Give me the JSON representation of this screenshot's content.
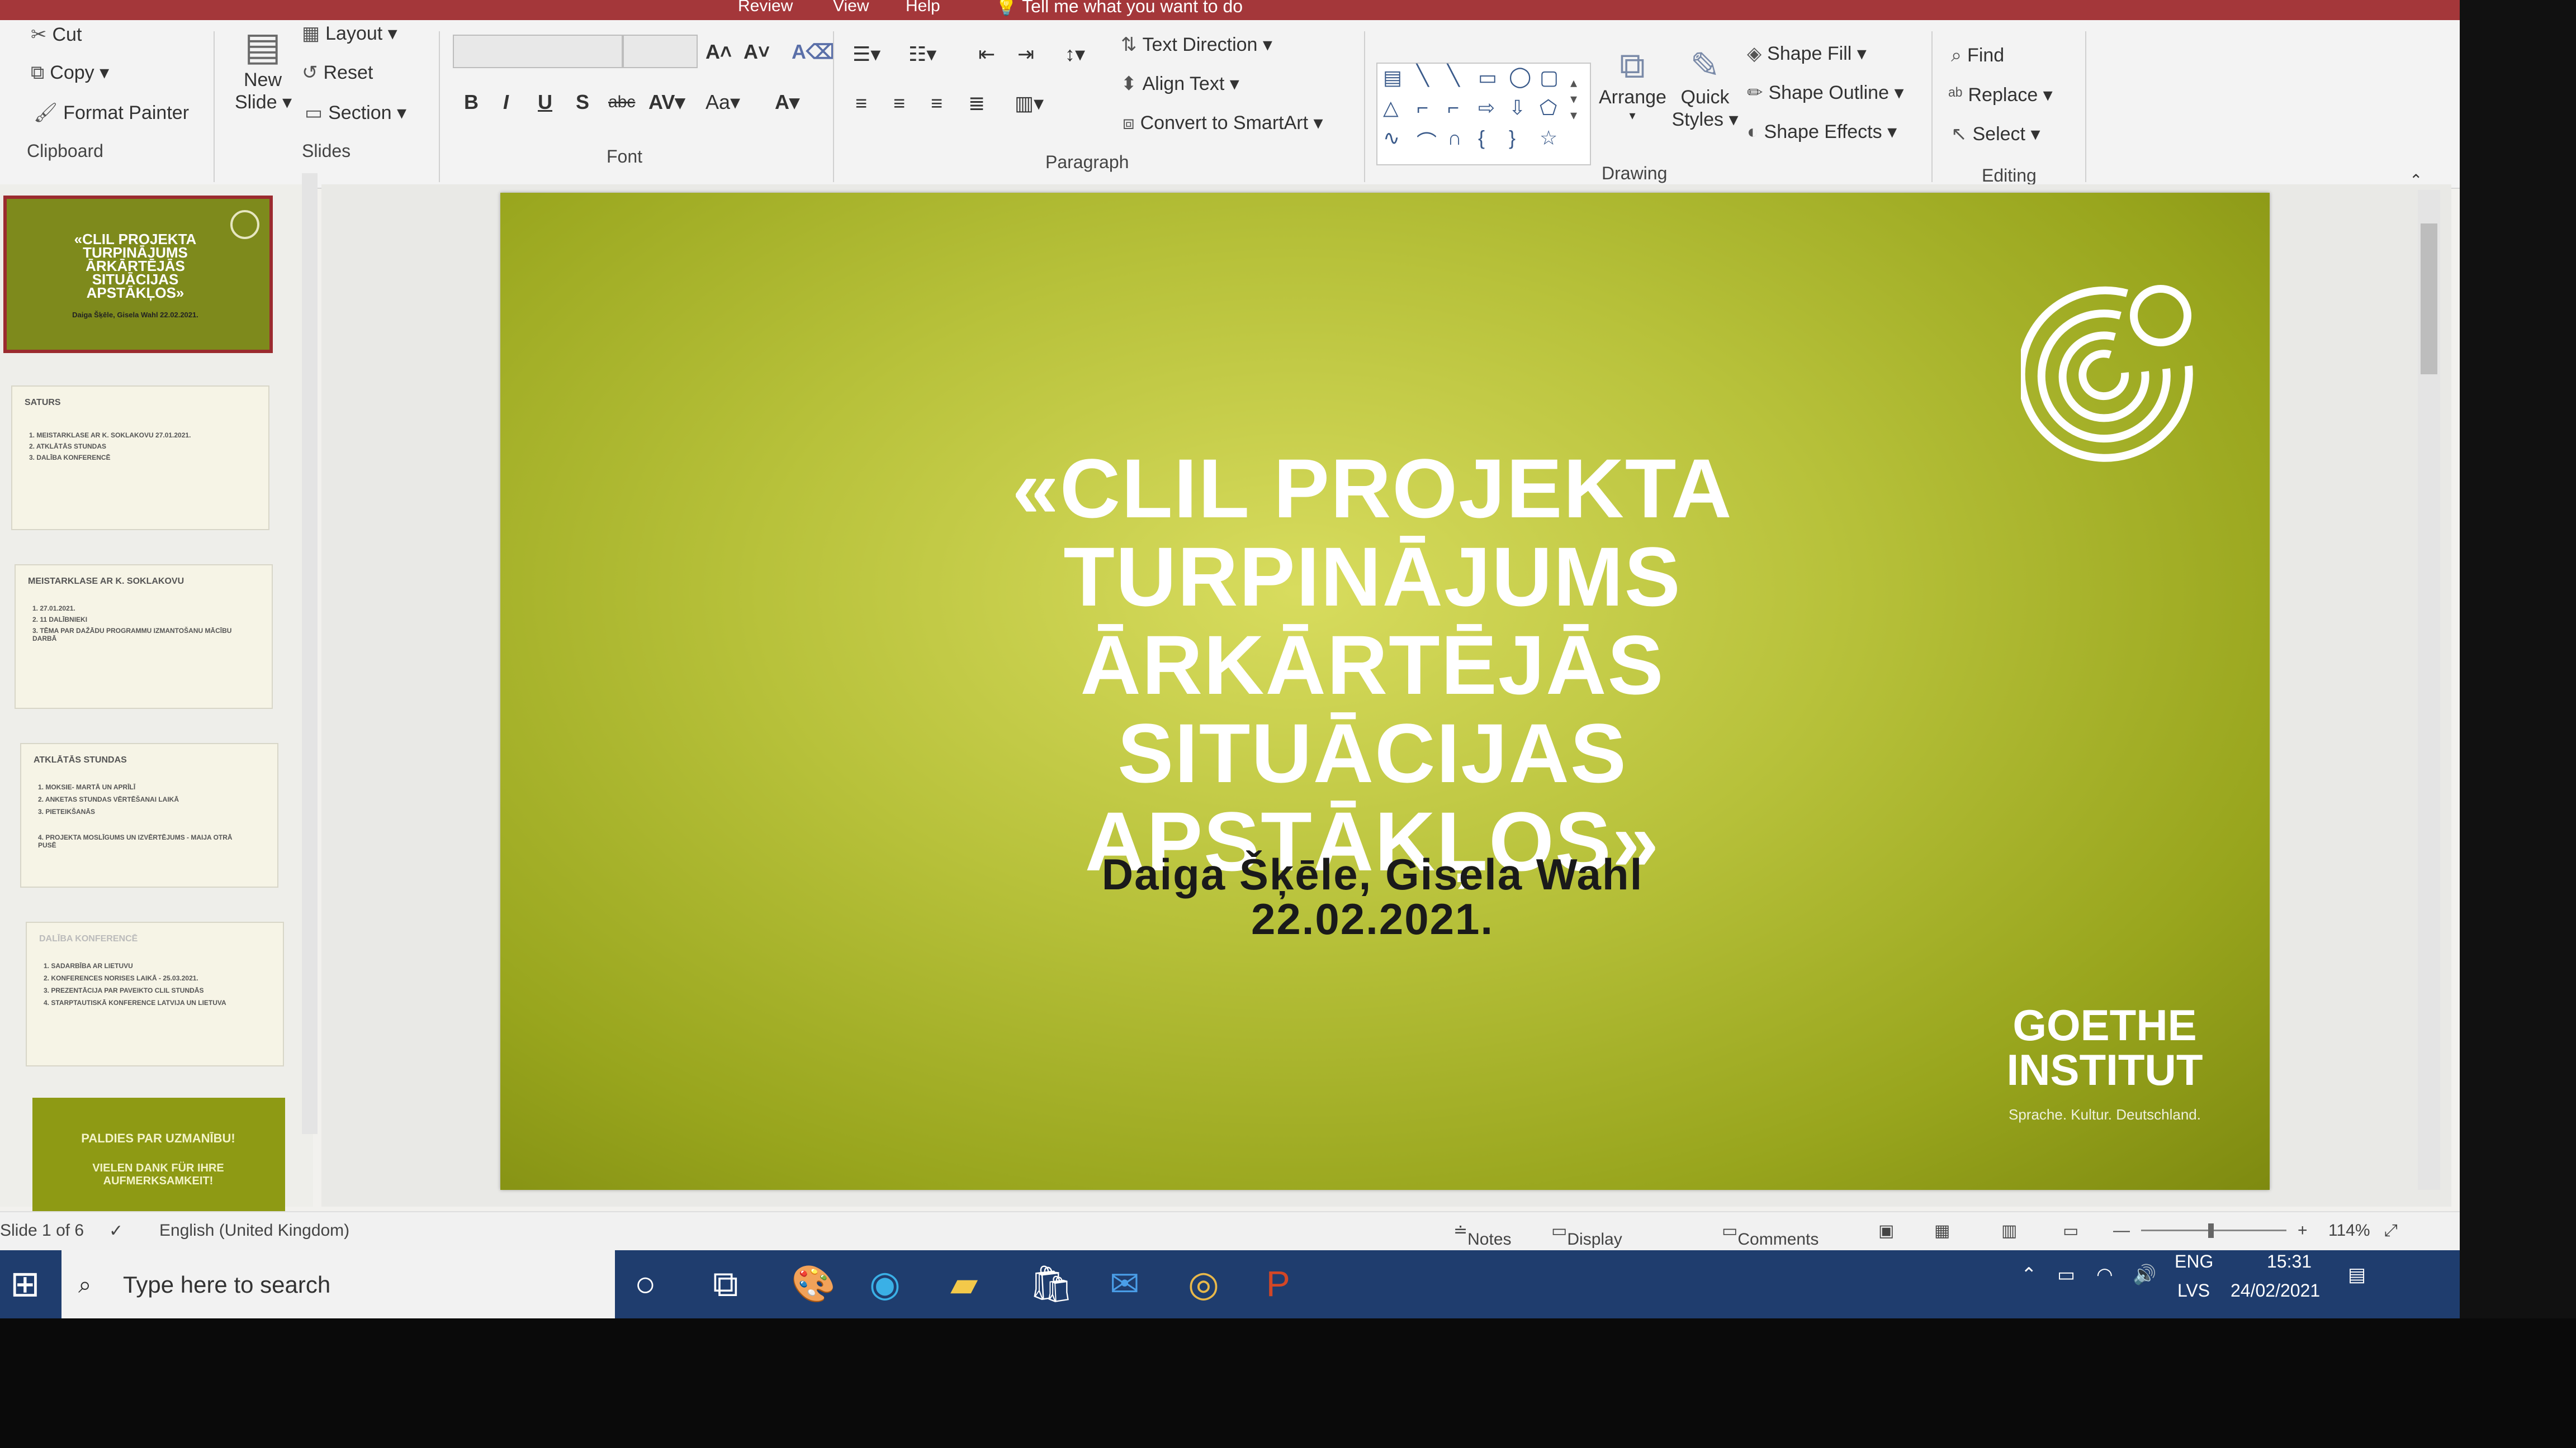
{
  "titlebar": {
    "tabs": [
      "Review",
      "View",
      "Help"
    ],
    "tell_me": "Tell me what you want to do"
  },
  "ribbon": {
    "clipboard": {
      "cut": "Cut",
      "copy": "Copy",
      "format_painter": "Format Painter",
      "group": "Clipboard"
    },
    "slides": {
      "new_slide_1": "New",
      "new_slide_2": "Slide",
      "layout": "Layout",
      "reset": "Reset",
      "section": "Section",
      "group": "Slides"
    },
    "font": {
      "group": "Font"
    },
    "paragraph": {
      "text_direction": "Text Direction",
      "align_text": "Align Text",
      "convert_smartart": "Convert to SmartArt",
      "group": "Paragraph"
    },
    "drawing": {
      "arrange": "Arrange",
      "quick_styles_1": "Quick",
      "quick_styles_2": "Styles",
      "shape_fill": "Shape Fill",
      "shape_outline": "Shape Outline",
      "shape_effects": "Shape Effects",
      "group": "Drawing"
    },
    "editing": {
      "find": "Find",
      "replace": "Replace",
      "select": "Select",
      "group": "Editing"
    }
  },
  "thumbnails": [
    {
      "title": "«CLIL PROJEKTA TURPINĀJUMS ĀRKĀRTĒJĀS SITUĀCIJAS APSTĀKĻOS»",
      "sub": "Daiga Šķēle, Gisela Wahl 22.02.2021."
    },
    {
      "title": "SATURS",
      "lines": [
        "1. MEISTARKLASE AR K. SOKLAKOVU 27.01.2021.",
        "2. ATKLĀTĀS STUNDAS",
        "3. DALĪBA KONFERENCĒ"
      ]
    },
    {
      "title": "MEISTARKLASE AR K. SOKLAKOVU",
      "lines": [
        "1. 27.01.2021.",
        "2. 11 DALĪBNIEKI",
        "3. TĒMA PAR DAŽĀDU PROGRAMMU IZMANTOŠANU MĀCĪBU DARBĀ"
      ]
    },
    {
      "title": "ATKLĀTĀS STUNDAS",
      "lines": [
        "1. MOKSIE- MARTĀ UN APRĪLĪ",
        "2. ANKETAS STUNDAS VĒRTĒŠANAI LAIKĀ",
        "3. PIETEIKŠANĀS",
        "4. PROJEKTA MOSLĪGUMS UN IZVĒRTĒJUMS - MAIJA OTRĀ PUSĒ"
      ]
    },
    {
      "title": "DALĪBA KONFERENCĒ",
      "lines": [
        "1. SADARBĪBA AR LIETUVU",
        "2. KONFERENCES NORISES LAIKĀ - 25.03.2021.",
        "3. PREZENTĀCIJA PAR PAVEIKTO CLIL STUNDĀS",
        "4. STARPTAUTISKĀ KONFERENCE LATVIJA UN LIETUVA"
      ]
    },
    {
      "title": "PALDIES PAR UZMANĪBU!",
      "sub": "VIELEN DANK FÜR IHRE AUFMERKSAMKEIT!"
    }
  ],
  "slide": {
    "title_lines": [
      "«CLIL PROJEKTA",
      "TURPINĀJUMS",
      "ĀRKĀRTĒJĀS SITUĀCIJAS",
      "APSTĀKĻOS»"
    ],
    "authors": "Daiga Šķēle, Gisela Wahl",
    "date": "22.02.2021.",
    "logo_name_1": "GOETHE",
    "logo_name_2": "INSTITUT",
    "logo_tagline": "Sprache. Kultur. Deutschland."
  },
  "status": {
    "slide_counter": "Slide 1 of 6",
    "language": "English (United Kingdom)",
    "notes": "Notes",
    "display_settings": "Display Settings",
    "comments": "Comments",
    "zoom": "114%"
  },
  "taskbar": {
    "search_placeholder": "Type here to search",
    "lang_1": "ENG",
    "lang_2": "LVS",
    "time": "15:31",
    "date": "24/02/2021"
  },
  "colors": {
    "accent": "#a4373a",
    "slide_green": "#9aa61e",
    "taskbar": "#1f3d6e"
  }
}
